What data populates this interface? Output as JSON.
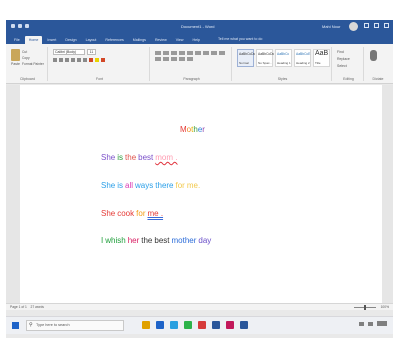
{
  "window": {
    "title": "Document1 - Word",
    "user": "Mahi Nour"
  },
  "tabs": [
    "File",
    "Home",
    "Insert",
    "Design",
    "Layout",
    "References",
    "Mailings",
    "Review",
    "View",
    "Help"
  ],
  "tell_me": "Tell me what you want to do",
  "ribbon": {
    "clipboard": {
      "paste": "Paste",
      "cut": "Cut",
      "copy": "Copy",
      "format_painter": "Format Painter",
      "label": "Clipboard"
    },
    "font": {
      "name": "Calibri (Body)",
      "size": "11",
      "label": "Font"
    },
    "paragraph": {
      "label": "Paragraph"
    },
    "styles": {
      "label": "Styles",
      "items": [
        {
          "sample": "AaBbCcDc",
          "name": "Normal"
        },
        {
          "sample": "AaBbCcDc",
          "name": "No Spac..."
        },
        {
          "sample": "AaBbCc",
          "name": "Heading 1"
        },
        {
          "sample": "AaBbCcE",
          "name": "Heading 2"
        },
        {
          "sample": "AaB",
          "name": "Title"
        }
      ]
    },
    "editing": {
      "find": "Find",
      "replace": "Replace",
      "select": "Select",
      "label": "Editing"
    },
    "voice": {
      "label": "Dictate"
    }
  },
  "document": {
    "title": "Mother",
    "lines": [
      [
        {
          "text": "She",
          "color": "#7a4fc9"
        },
        {
          "text": "is",
          "color": "#2a9a3a"
        },
        {
          "text": "the",
          "color": "#e0524a"
        },
        {
          "text": "best",
          "color": "#7a4fc9"
        },
        {
          "text": "mom .",
          "color": "#ff9bb1",
          "style": "ul-red"
        }
      ],
      [
        {
          "text": "She",
          "color": "#2b9fe8"
        },
        {
          "text": "is",
          "color": "#2b9fe8"
        },
        {
          "text": "all",
          "color": "#d93ab4"
        },
        {
          "text": "ways",
          "color": "#2b9fe8"
        },
        {
          "text": "there",
          "color": "#2b9fe8"
        },
        {
          "text": "for",
          "color": "#f2c94c"
        },
        {
          "text": "me.",
          "color": "#f2c94c"
        }
      ],
      [
        {
          "text": "She",
          "color": "#e53935"
        },
        {
          "text": "cook",
          "color": "#e53935"
        },
        {
          "text": "for",
          "color": "#f39c12"
        },
        {
          "text": "me .",
          "color": "#e53935",
          "style": "ul-blue"
        }
      ],
      [
        {
          "text": "I",
          "color": "#1e9e3a"
        },
        {
          "text": "whish",
          "color": "#1e9e3a"
        },
        {
          "text": "her",
          "color": "#d81b60"
        },
        {
          "text": "the",
          "color": "#333333"
        },
        {
          "text": "best",
          "color": "#333333"
        },
        {
          "text": "mother",
          "color": "#2b6cd9"
        },
        {
          "text": "day",
          "color": "#6a4fc9"
        }
      ]
    ],
    "title_colors": [
      "#e53935",
      "#f08a24",
      "#e2b400",
      "#3a9d3a",
      "#2b7fd9",
      "#8e44ad"
    ]
  },
  "status": {
    "page": "Page 1 of 1",
    "words": "27 words",
    "zoom": "100%"
  },
  "taskbar": {
    "search_placeholder": "Type here to search"
  },
  "colors": {
    "word_blue": "#2b579a",
    "taskbar_icons": [
      "#e0a100",
      "#1e63c8",
      "#29a0e0",
      "#2db34a",
      "#d63b3b",
      "#2b579a",
      "#c2185b",
      "#2b579a"
    ]
  }
}
